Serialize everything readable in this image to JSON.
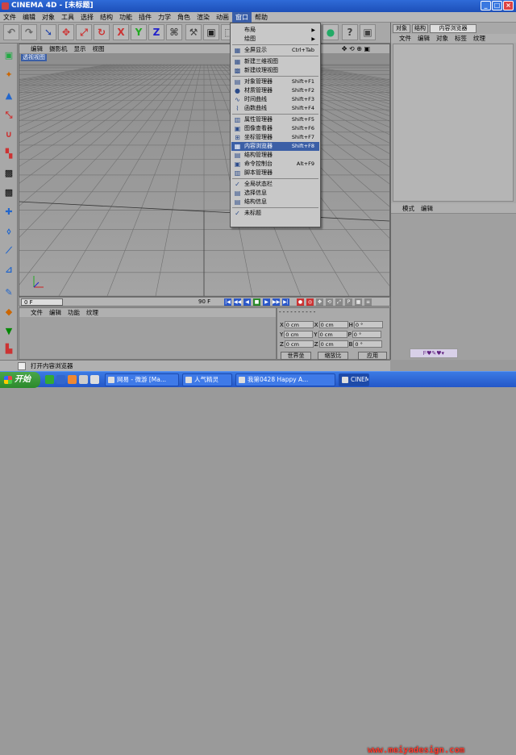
{
  "window": {
    "title": "CINEMA 4D - [未标题]"
  },
  "menubar": [
    "文件",
    "编辑",
    "对象",
    "工具",
    "选择",
    "结构",
    "功能",
    "插件",
    "力学",
    "角色",
    "渲染",
    "动画",
    "窗口",
    "帮助"
  ],
  "active_menu_index": 12,
  "toolbar": {
    "icons": [
      "undo-icon",
      "redo-icon",
      "select-icon",
      "move-icon",
      "scale-icon",
      "rotate-icon",
      "x-axis-icon",
      "y-axis-icon",
      "z-axis-icon",
      "coord-system-icon",
      "model-mode-icon",
      "object-mode-icon",
      "texture-mode-icon"
    ],
    "labels": [
      "↶",
      "↷",
      "➘",
      "✥",
      "⤢",
      "↻",
      "X",
      "Y",
      "Z",
      "⌘",
      "⚒",
      "▣",
      "⬚"
    ]
  },
  "dropdown": {
    "items": [
      {
        "label": "布局",
        "shortcut": "",
        "submenu": true,
        "icon": "",
        "sep_after": false
      },
      {
        "label": "绘图",
        "shortcut": "",
        "submenu": true,
        "icon": "",
        "sep_after": true
      },
      {
        "label": "全屏显示",
        "shortcut": "Ctrl+Tab",
        "submenu": false,
        "icon": "▦",
        "sep_after": true
      },
      {
        "label": "新建三维视图",
        "shortcut": "",
        "submenu": false,
        "icon": "▦",
        "sep_after": false
      },
      {
        "label": "新建纹理视图",
        "shortcut": "",
        "submenu": false,
        "icon": "▩",
        "sep_after": true
      },
      {
        "label": "对象管理器",
        "shortcut": "Shift+F1",
        "submenu": false,
        "icon": "▤",
        "sep_after": false
      },
      {
        "label": "材质管理器",
        "shortcut": "Shift+F2",
        "submenu": false,
        "icon": "●",
        "sep_after": false
      },
      {
        "label": "时间曲线",
        "shortcut": "Shift+F3",
        "submenu": false,
        "icon": "∿",
        "sep_after": false
      },
      {
        "label": "函数曲线",
        "shortcut": "Shift+F4",
        "submenu": false,
        "icon": "⌇",
        "sep_after": true
      },
      {
        "label": "属性管理器",
        "shortcut": "Shift+F5",
        "submenu": false,
        "icon": "▥",
        "sep_after": false
      },
      {
        "label": "图像查看器",
        "shortcut": "Shift+F6",
        "submenu": false,
        "icon": "▣",
        "sep_after": false
      },
      {
        "label": "坐标管理器",
        "shortcut": "Shift+F7",
        "submenu": false,
        "icon": "⊞",
        "sep_after": false
      },
      {
        "label": "内容浏览器",
        "shortcut": "Shift+F8",
        "submenu": false,
        "icon": "▦",
        "sep_after": false,
        "highlight": true
      },
      {
        "label": "结构管理器",
        "shortcut": "",
        "submenu": false,
        "icon": "▤",
        "sep_after": false
      },
      {
        "label": "命令控制台",
        "shortcut": "Alt+F9",
        "submenu": false,
        "icon": "▣",
        "sep_after": false
      },
      {
        "label": "脚本管理器",
        "shortcut": "",
        "submenu": false,
        "icon": "▥",
        "sep_after": true
      },
      {
        "label": "全局状态栏",
        "shortcut": "",
        "submenu": false,
        "icon": "✓",
        "sep_after": false
      },
      {
        "label": "选择信息",
        "shortcut": "",
        "submenu": false,
        "icon": "▤",
        "sep_after": false
      },
      {
        "label": "结构信息",
        "shortcut": "",
        "submenu": false,
        "icon": "▤",
        "sep_after": true
      },
      {
        "label": "未标题",
        "shortcut": "",
        "submenu": false,
        "icon": "✓",
        "sep_after": false
      }
    ]
  },
  "viewport": {
    "menu": [
      "编辑",
      "摄影机",
      "显示",
      "视图"
    ],
    "label": "透视视图"
  },
  "timeline": {
    "frame_start": "0 F",
    "frame_end": "90 F"
  },
  "material_manager": {
    "menu": [
      "文件",
      "编辑",
      "功能",
      "纹理"
    ]
  },
  "coords": {
    "rows": [
      {
        "a": "X",
        "av": "0 cm",
        "b": "X",
        "bv": "0 cm",
        "c": "H",
        "cv": "0 °"
      },
      {
        "a": "Y",
        "av": "0 cm",
        "b": "Y",
        "bv": "0 cm",
        "c": "P",
        "cv": "0 °"
      },
      {
        "a": "Z",
        "av": "0 cm",
        "b": "Z",
        "bv": "0 cm",
        "c": "B",
        "cv": "0 °"
      }
    ],
    "world_btn": "世界坐",
    "scale_btn": "缩放比",
    "apply_btn": "应用"
  },
  "object_panel": {
    "tabs": [
      "对象",
      "结构",
      "内容浏览器"
    ],
    "menu": [
      "文件",
      "编辑",
      "对象",
      "标签",
      "纹理"
    ]
  },
  "attr_panel": {
    "menu": [
      "模式",
      "编辑"
    ]
  },
  "logo_text": "ᖴ♥✎♥▾",
  "status": {
    "text": "打开内容浏览器"
  },
  "taskbar": {
    "start_label": "开始",
    "tasks": [
      "网易 - 微游 [Ma...",
      "人气精灵",
      "我第0428 Happy A...",
      "CINEMA 4D - ..."
    ],
    "watermark": "www.meiyadesign.com"
  },
  "colors": {
    "highlight": "#3b5fa6",
    "title": "#1d4fb8",
    "viewport": "#9c9c9c"
  }
}
